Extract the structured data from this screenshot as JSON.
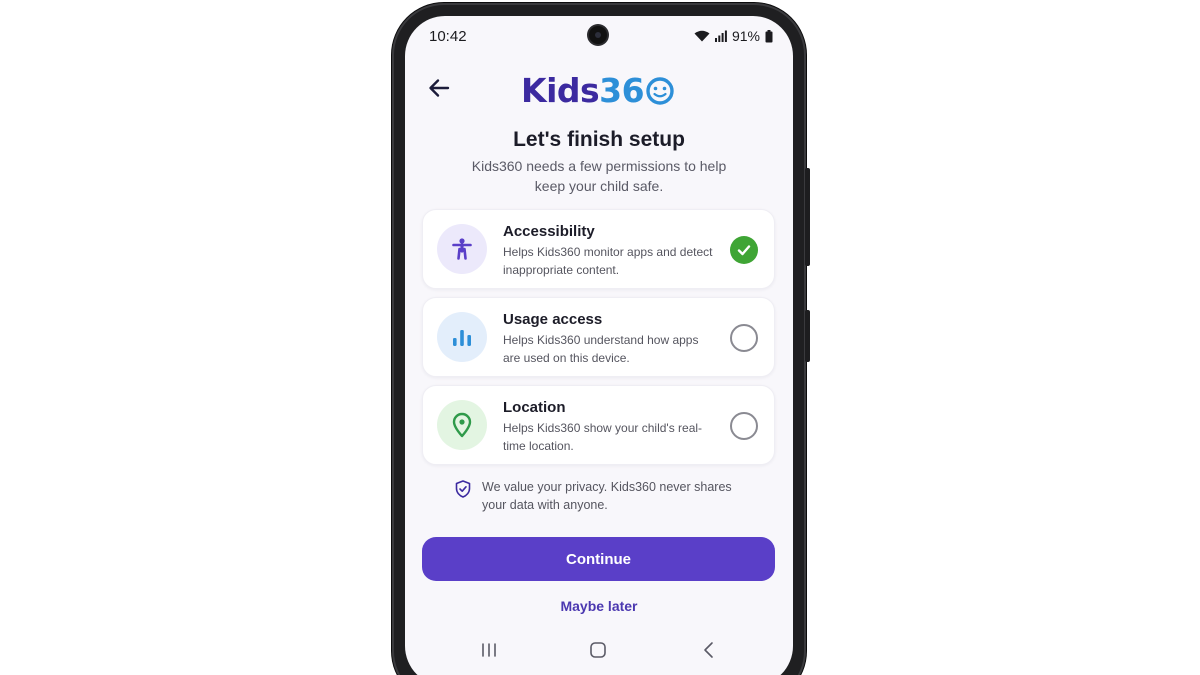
{
  "status_bar": {
    "time": "10:42",
    "battery": "91%"
  },
  "app": {
    "logo_main": "Kids",
    "logo_num": "36"
  },
  "header": {
    "title": "Let's finish setup",
    "subtitle": "Kids360 needs a few permissions to help keep your child safe."
  },
  "permissions": [
    {
      "title": "Accessibility",
      "description": "Helps Kids360 monitor apps and detect inappropriate content.",
      "granted": true
    },
    {
      "title": "Usage access",
      "description": "Helps Kids360 understand how apps are used on this device.",
      "granted": false
    },
    {
      "title": "Location",
      "description": "Helps Kids360 show your child's real-time location.",
      "granted": false
    }
  ],
  "privacy_note": "We value your privacy. Kids360 never shares your data with anyone.",
  "actions": {
    "continue_label": "Continue",
    "later_label": "Maybe later"
  },
  "colors": {
    "accent": "#5a3fc8",
    "logo_primary": "#3c2aa0",
    "logo_secondary": "#2d8fd8",
    "success": "#3fa535",
    "background": "#f8f7fb"
  },
  "icons": {
    "back": "arrow-left-icon",
    "accessibility": "accessibility-person-icon",
    "usage": "bar-chart-icon",
    "location": "map-pin-icon",
    "check": "check-icon",
    "privacy": "shield-check-icon",
    "nav_recents": "recents-icon",
    "nav_home": "home-icon",
    "nav_back": "nav-back-icon"
  }
}
